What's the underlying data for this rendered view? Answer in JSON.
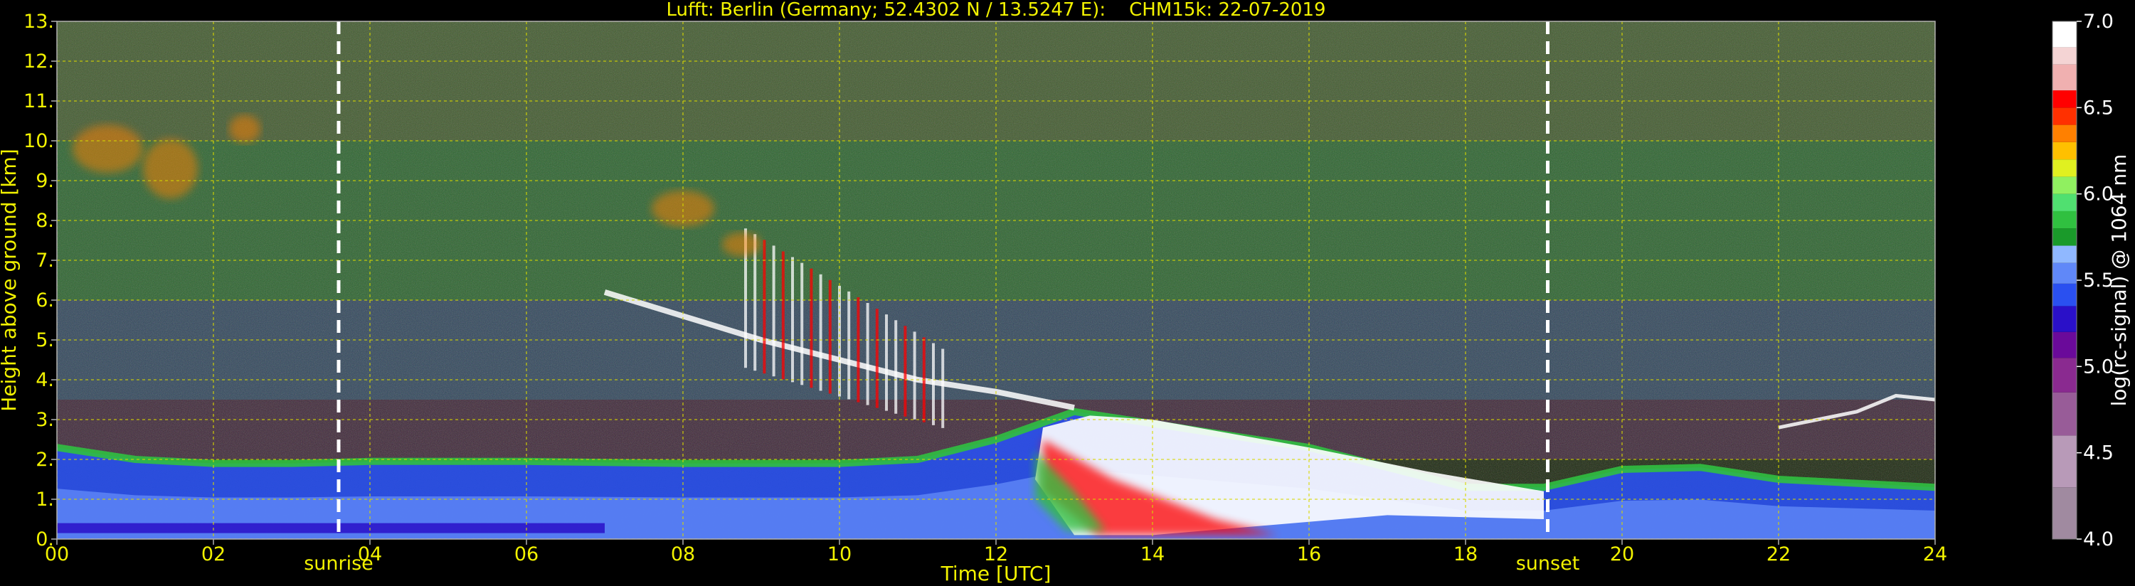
{
  "chart_data": {
    "type": "heatmap",
    "title": "Lufft: Berlin (Germany; 52.4302 N / 13.5247 E):    CHM15k: 22-07-2019",
    "xlabel": "Time [UTC]",
    "ylabel": "Height above ground [km]",
    "xlim": [
      0,
      24
    ],
    "ylim": [
      0,
      13
    ],
    "grid": true,
    "x_ticks": [
      {
        "value": 0,
        "label": "00"
      },
      {
        "value": 2,
        "label": "02"
      },
      {
        "value": 4,
        "label": "04"
      },
      {
        "value": 6,
        "label": "06"
      },
      {
        "value": 8,
        "label": "08"
      },
      {
        "value": 10,
        "label": "10"
      },
      {
        "value": 12,
        "label": "12"
      },
      {
        "value": 14,
        "label": "14"
      },
      {
        "value": 16,
        "label": "16"
      },
      {
        "value": 18,
        "label": "18"
      },
      {
        "value": 20,
        "label": "20"
      },
      {
        "value": 22,
        "label": "22"
      },
      {
        "value": 24,
        "label": "24"
      }
    ],
    "y_ticks": [
      {
        "value": 0,
        "label": "0."
      },
      {
        "value": 1,
        "label": "1."
      },
      {
        "value": 2,
        "label": "2."
      },
      {
        "value": 3,
        "label": "3."
      },
      {
        "value": 4,
        "label": "4."
      },
      {
        "value": 5,
        "label": "5."
      },
      {
        "value": 6,
        "label": "6."
      },
      {
        "value": 7,
        "label": "7."
      },
      {
        "value": 8,
        "label": "8."
      },
      {
        "value": 9,
        "label": "9."
      },
      {
        "value": 10,
        "label": "10."
      },
      {
        "value": 11,
        "label": "11."
      },
      {
        "value": 12,
        "label": "12."
      },
      {
        "value": 13,
        "label": "13."
      }
    ],
    "markers": [
      {
        "label": "sunrise",
        "x": 3.6
      },
      {
        "label": "sunset",
        "x": 19.05
      }
    ],
    "colorbar": {
      "label": "log(rc-signal) @ 1064 nm",
      "range": [
        4.0,
        7.0
      ],
      "ticks": [
        {
          "value": 4.0,
          "label": "4.0"
        },
        {
          "value": 4.5,
          "label": "4.5"
        },
        {
          "value": 5.0,
          "label": "5.0"
        },
        {
          "value": 5.5,
          "label": "5.5"
        },
        {
          "value": 6.0,
          "label": "6.0"
        },
        {
          "value": 6.5,
          "label": "6.5"
        },
        {
          "value": 7.0,
          "label": "7.0"
        }
      ],
      "bands": [
        {
          "from": 4.0,
          "to": 4.3,
          "color": "#a08aa0"
        },
        {
          "from": 4.3,
          "to": 4.6,
          "color": "#b89ab8"
        },
        {
          "from": 4.6,
          "to": 4.85,
          "color": "#985c98"
        },
        {
          "from": 4.85,
          "to": 5.05,
          "color": "#8a2a90"
        },
        {
          "from": 5.05,
          "to": 5.2,
          "color": "#6a0a9a"
        },
        {
          "from": 5.2,
          "to": 5.35,
          "color": "#2a10c8"
        },
        {
          "from": 5.35,
          "to": 5.48,
          "color": "#2a50f0"
        },
        {
          "from": 5.48,
          "to": 5.6,
          "color": "#6088f8"
        },
        {
          "from": 5.6,
          "to": 5.7,
          "color": "#90b8ff"
        },
        {
          "from": 5.7,
          "to": 5.8,
          "color": "#1a9a2a"
        },
        {
          "from": 5.8,
          "to": 5.9,
          "color": "#30c040"
        },
        {
          "from": 5.9,
          "to": 6.0,
          "color": "#50e070"
        },
        {
          "from": 6.0,
          "to": 6.1,
          "color": "#90f060"
        },
        {
          "from": 6.1,
          "to": 6.2,
          "color": "#e0f020"
        },
        {
          "from": 6.2,
          "to": 6.3,
          "color": "#ffc000"
        },
        {
          "from": 6.3,
          "to": 6.4,
          "color": "#ff8000"
        },
        {
          "from": 6.4,
          "to": 6.5,
          "color": "#ff3000"
        },
        {
          "from": 6.5,
          "to": 6.6,
          "color": "#ff0000"
        },
        {
          "from": 6.6,
          "to": 6.75,
          "color": "#f0b0b0"
        },
        {
          "from": 6.75,
          "to": 6.85,
          "color": "#f4d4d4"
        },
        {
          "from": 6.85,
          "to": 7.0,
          "color": "#ffffff"
        }
      ]
    },
    "features": {
      "boundary_layer_top_km": [
        [
          0,
          2.3
        ],
        [
          1,
          2.0
        ],
        [
          2,
          1.9
        ],
        [
          3,
          1.9
        ],
        [
          4,
          1.95
        ],
        [
          6,
          1.95
        ],
        [
          8,
          1.9
        ],
        [
          10,
          1.9
        ],
        [
          11,
          2.0
        ],
        [
          12,
          2.5
        ],
        [
          13,
          3.2
        ],
        [
          14,
          2.9
        ],
        [
          15,
          2.6
        ],
        [
          16,
          2.3
        ],
        [
          17,
          1.8
        ],
        [
          18,
          1.3
        ],
        [
          19,
          1.3
        ],
        [
          20,
          1.75
        ],
        [
          21,
          1.8
        ],
        [
          22,
          1.5
        ],
        [
          23,
          1.4
        ],
        [
          24,
          1.3
        ]
      ],
      "descending_cloud_layer_km": [
        [
          7,
          6.2
        ],
        [
          8,
          5.6
        ],
        [
          9,
          5.0
        ],
        [
          10,
          4.5
        ],
        [
          11,
          4.0
        ],
        [
          12,
          3.7
        ],
        [
          13,
          3.3
        ]
      ],
      "late_aerosol_layer_km": [
        [
          22,
          2.8
        ],
        [
          22.5,
          3.0
        ],
        [
          23,
          3.2
        ],
        [
          23.5,
          3.6
        ],
        [
          24,
          3.5
        ]
      ]
    }
  }
}
